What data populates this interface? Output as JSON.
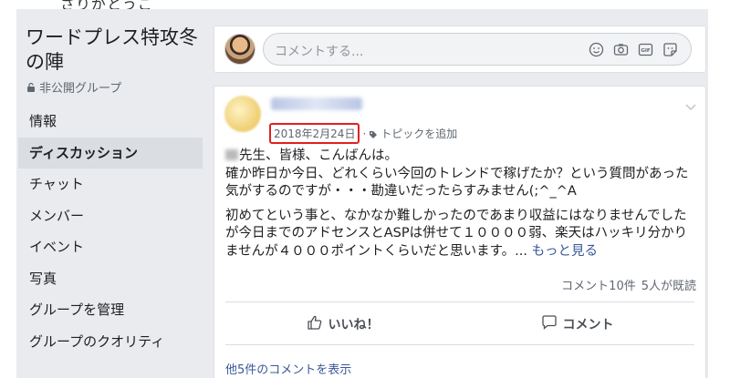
{
  "top_cut_text": "さりがとうご",
  "sidebar": {
    "group_name": "ワードプレス特攻冬の陣",
    "privacy": "非公開グループ",
    "items": [
      {
        "label": "情報"
      },
      {
        "label": "ディスカッション"
      },
      {
        "label": "チャット"
      },
      {
        "label": "メンバー"
      },
      {
        "label": "イベント"
      },
      {
        "label": "写真"
      },
      {
        "label": "グループを管理"
      },
      {
        "label": "グループのクオリティ"
      }
    ],
    "active_item": "ディスカッション"
  },
  "composer": {
    "placeholder": "コメントする...",
    "icons": [
      "emoji-icon",
      "camera-icon",
      "gif-icon",
      "sticker-icon"
    ]
  },
  "post": {
    "date": "2018年2月24日",
    "topic_label": "トピックを追加",
    "paragraph1_suffix": "先生、皆様、こんばんは。",
    "paragraph1_rest": "確か昨日か今日、どれくらい今回のトレンドで稼げたか？という質問があった気がするのですが・・・勘違いだったらすみません(;^_^A",
    "paragraph2": "初めてという事と、なかなか難しかったのであまり収益にはなりませんでしたが今日までのアドセンスとASPは併せて１００００弱、楽天はハッキリ分かりませんが４０００ポイントくらいだと思います。...",
    "see_more": "もっと見る",
    "comment_count": "コメント10件",
    "seen_count": "5人が既読",
    "like_label": "いいね！",
    "comment_label": "コメント",
    "view_more_comments": "他5件のコメントを表示"
  },
  "colors": {
    "accent_link": "#385898",
    "highlight_border": "#e02020",
    "background": "#e9ebee"
  }
}
